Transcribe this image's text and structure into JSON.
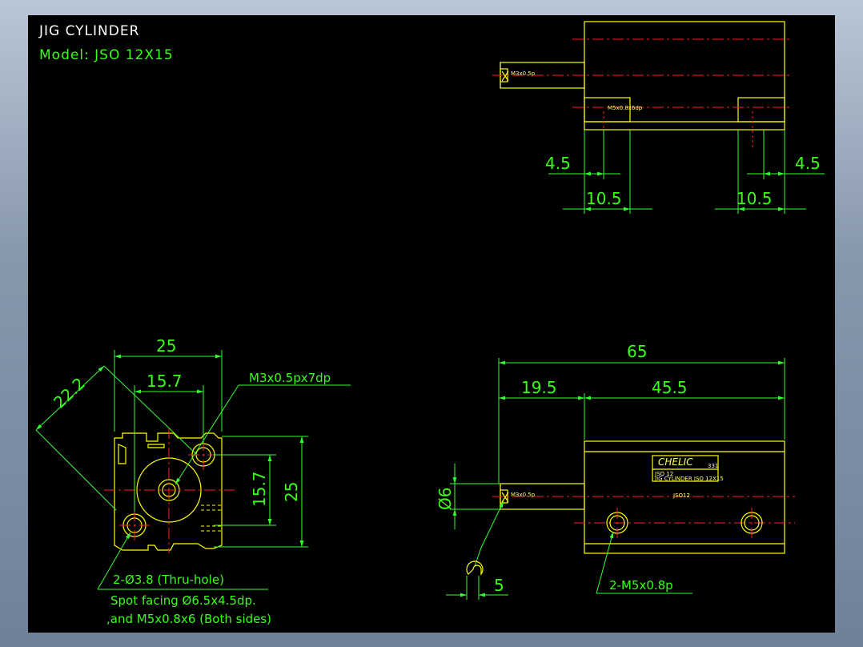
{
  "title": {
    "line1": "JIG CYLINDER",
    "line2": "Model:  JSO 12X15"
  },
  "colors": {
    "background": "#000000",
    "outline": "#ffff00",
    "dimension": "#39ff14",
    "centerline": "#ff2020",
    "title": "#ffffff"
  },
  "top_view": {
    "dims": {
      "left_small": "4.5",
      "right_small": "4.5",
      "left_large": "10.5",
      "right_large": "10.5"
    },
    "port_label": "M5x0.8x6dp",
    "rod_label": "M3x0.5p"
  },
  "end_view": {
    "dims": {
      "width": "25",
      "inner_width": "15.7",
      "diagonal": "22.2",
      "inner_height": "15.7",
      "height": "25"
    },
    "callout_thread": "M3x0.5px7dp",
    "note_lines": [
      "2-Ø3.8 (Thru-hole)",
      "Spot facing  Ø6.5x4.5dp.",
      ",and M5x0.8x6 (Both sides)"
    ]
  },
  "side_view": {
    "dims": {
      "overall": "65",
      "rod": "19.5",
      "body": "45.5",
      "rod_dia": "Ø6",
      "rod_flat": "5"
    },
    "ports_label": "2-M5x0.8p",
    "rod_label": "M3x0.5p",
    "nameplate": {
      "brand": "CHELIC",
      "code": "331",
      "line1": "JSO 12",
      "line2": "JIG CYLINDER JSO 12X15",
      "model_mark": "JSO12"
    }
  }
}
